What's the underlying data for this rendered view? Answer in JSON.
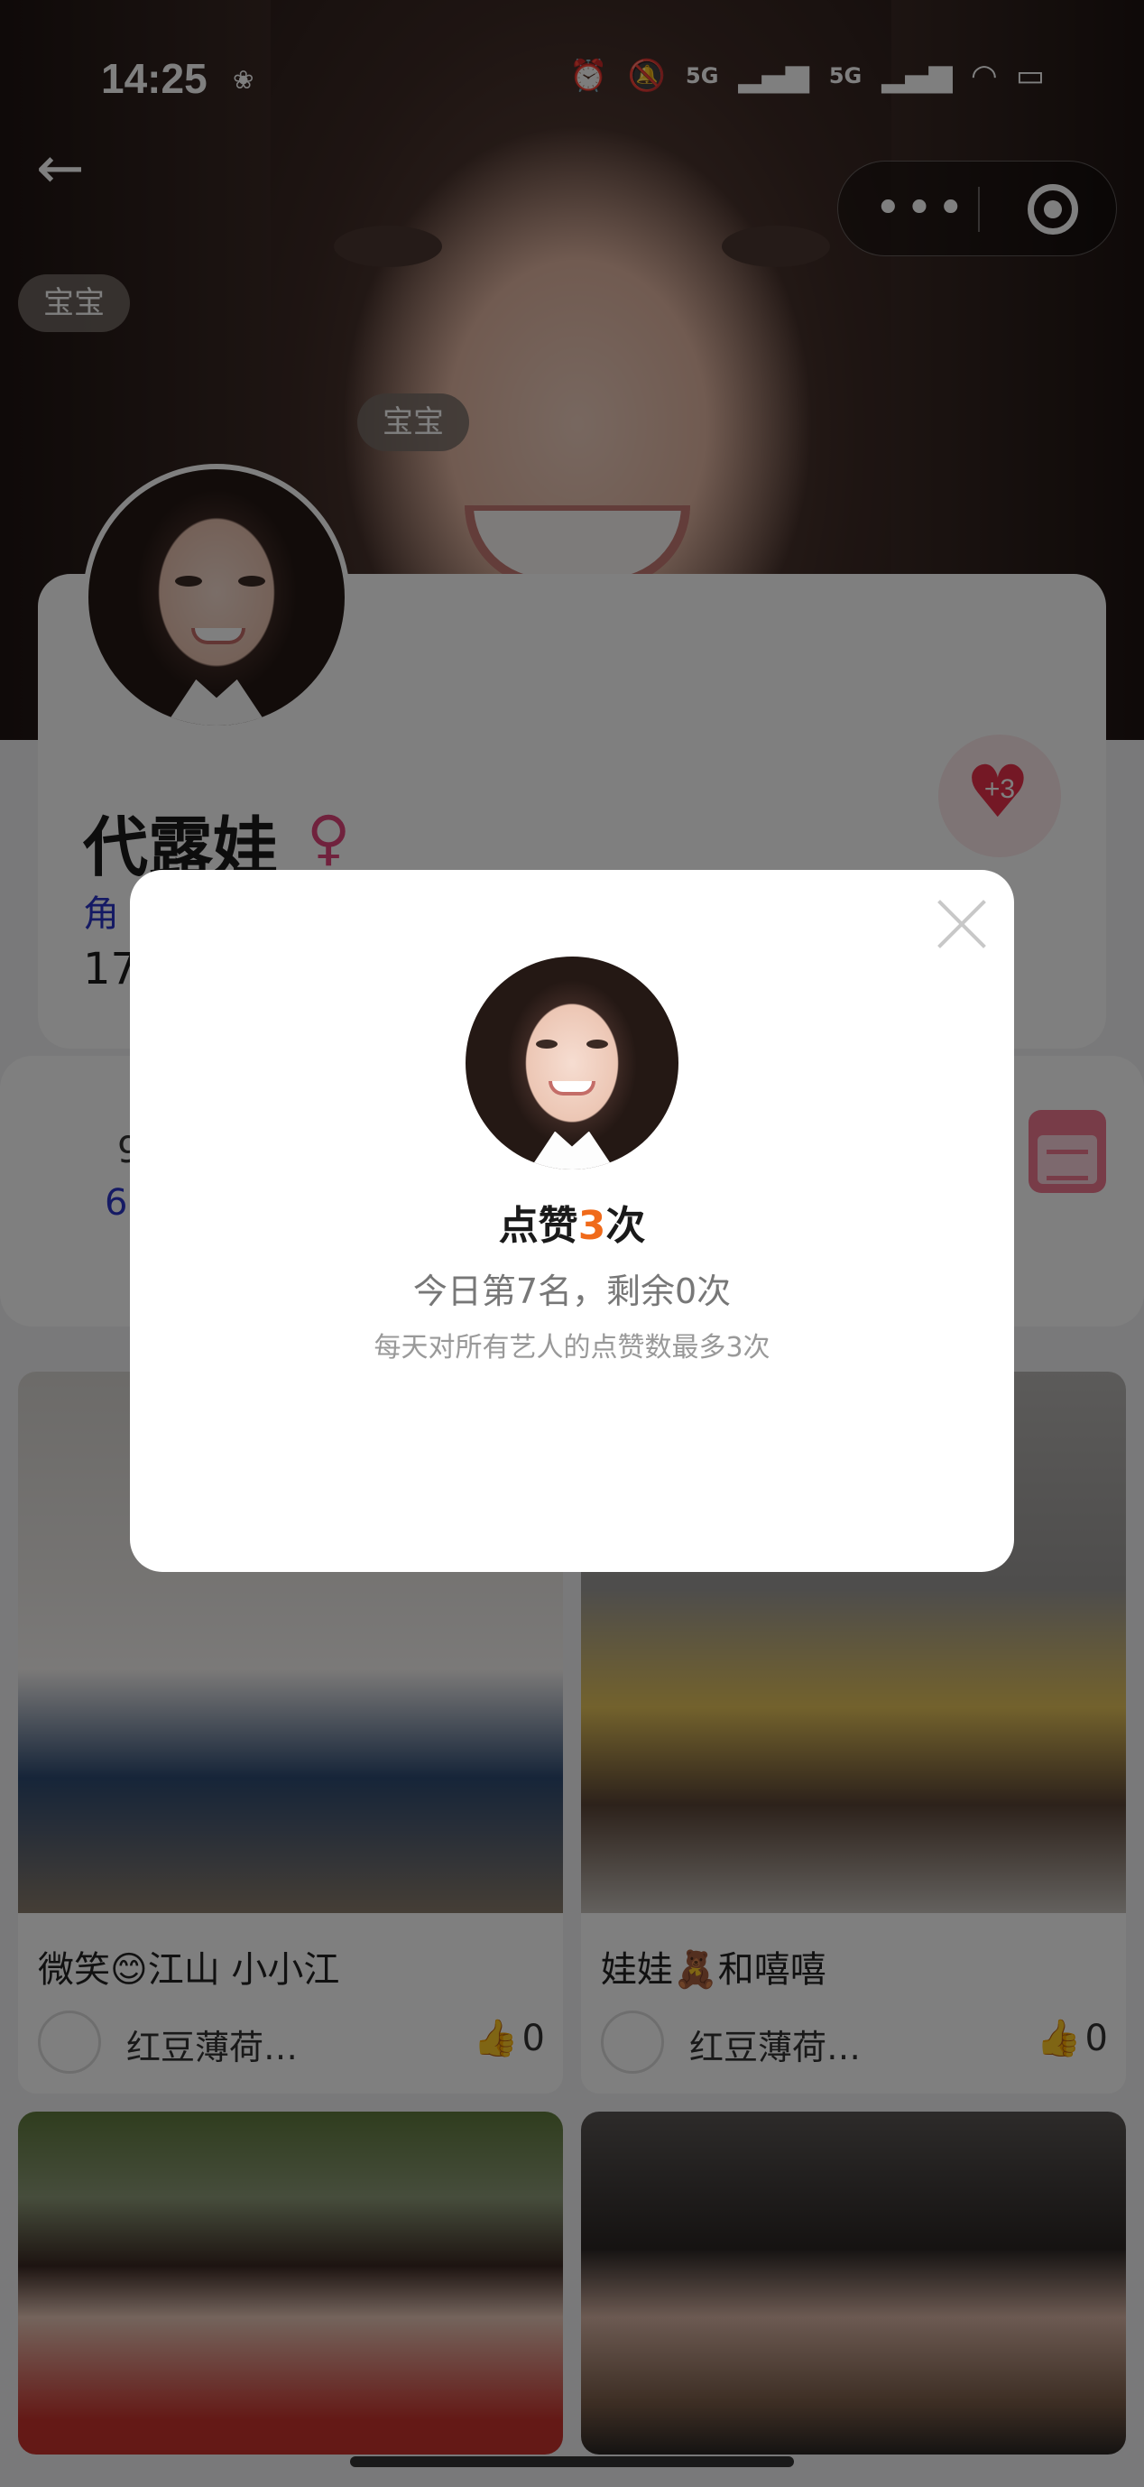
{
  "status_bar": {
    "time": "14:25",
    "network_left": "5G",
    "network_right": "5G"
  },
  "hero": {
    "tag_left": "宝宝",
    "tag_center": "宝宝"
  },
  "profile": {
    "name": "代露娃",
    "role_partial": "角",
    "number_partial": "17",
    "like_badge": "+3"
  },
  "stats": {
    "line1_partial": "9",
    "line2_partial": "6"
  },
  "posts": [
    {
      "title": "微笑😊江山 小小江",
      "author": "红豆薄荷…",
      "likes": "0"
    },
    {
      "title": "娃娃🧸和嘻嘻",
      "author": "红豆薄荷…",
      "likes": "0"
    },
    {
      "title": "",
      "author": "",
      "likes": ""
    },
    {
      "title": "",
      "author": "",
      "likes": ""
    }
  ],
  "modal": {
    "title_prefix": "点赞",
    "title_count": "3",
    "title_suffix": "次",
    "subtitle": "今日第7名，剩余0次",
    "note": "每天对所有艺人的点赞数最多3次"
  },
  "colors": {
    "accent": "#f06a1a",
    "heart": "#e8304a",
    "role_blue": "#2b35c8"
  }
}
